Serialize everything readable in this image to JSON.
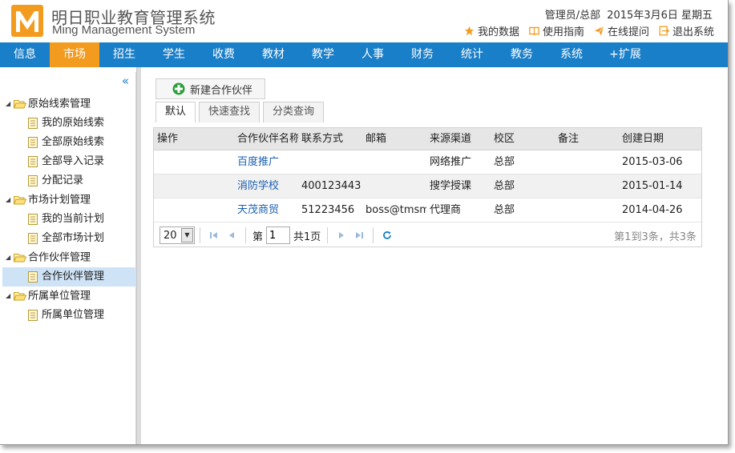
{
  "header": {
    "title": "明日职业教育管理系统",
    "subtitle": "Ming Management System",
    "user": "管理员/总部",
    "date": "2015年3月6日 星期五",
    "links": [
      {
        "label": "我的数据",
        "icon": "star-icon"
      },
      {
        "label": "使用指南",
        "icon": "book-icon"
      },
      {
        "label": "在线提问",
        "icon": "send-icon"
      },
      {
        "label": "退出系统",
        "icon": "logout-icon"
      }
    ],
    "colors": {
      "brand": "#f39b1f",
      "nav": "#1a7fc9"
    }
  },
  "nav": {
    "items": [
      "信息",
      "市场",
      "招生",
      "学生",
      "收费",
      "教材",
      "教学",
      "人事",
      "财务",
      "统计",
      "教务",
      "系统",
      "+扩展"
    ],
    "active": "市场"
  },
  "sidebar": {
    "collapse_label": "«",
    "groups": [
      {
        "label": "原始线索管理",
        "items": [
          "我的原始线索",
          "全部原始线索",
          "全部导入记录",
          "分配记录"
        ]
      },
      {
        "label": "市场计划管理",
        "items": [
          "我的当前计划",
          "全部市场计划"
        ]
      },
      {
        "label": "合作伙伴管理",
        "items": [
          "合作伙伴管理"
        ]
      },
      {
        "label": "所属单位管理",
        "items": [
          "所属单位管理"
        ]
      }
    ],
    "selected": "合作伙伴管理"
  },
  "toolbar": {
    "new_label": "新建合作伙伴"
  },
  "tabs": [
    "默认",
    "快速查找",
    "分类查询"
  ],
  "table": {
    "columns": [
      "操作",
      "合作伙伴名称",
      "联系方式",
      "邮箱",
      "来源渠道",
      "校区",
      "备注",
      "创建日期"
    ],
    "rows": [
      [
        "",
        "百度推广",
        "",
        "",
        "网络推广",
        "总部",
        "",
        "2015-03-06"
      ],
      [
        "",
        "消防学校",
        "400123443",
        "",
        "搜学授课",
        "总部",
        "",
        "2015-01-14"
      ],
      [
        "",
        "天茂商贸",
        "51223456",
        "boss@tmsm",
        "代理商",
        "总部",
        "",
        "2014-04-26"
      ]
    ]
  },
  "pager": {
    "page_size": "20",
    "page_label_before": "第",
    "page_value": "1",
    "page_label_after": "共1页",
    "info": "第1到3条，共3条"
  }
}
